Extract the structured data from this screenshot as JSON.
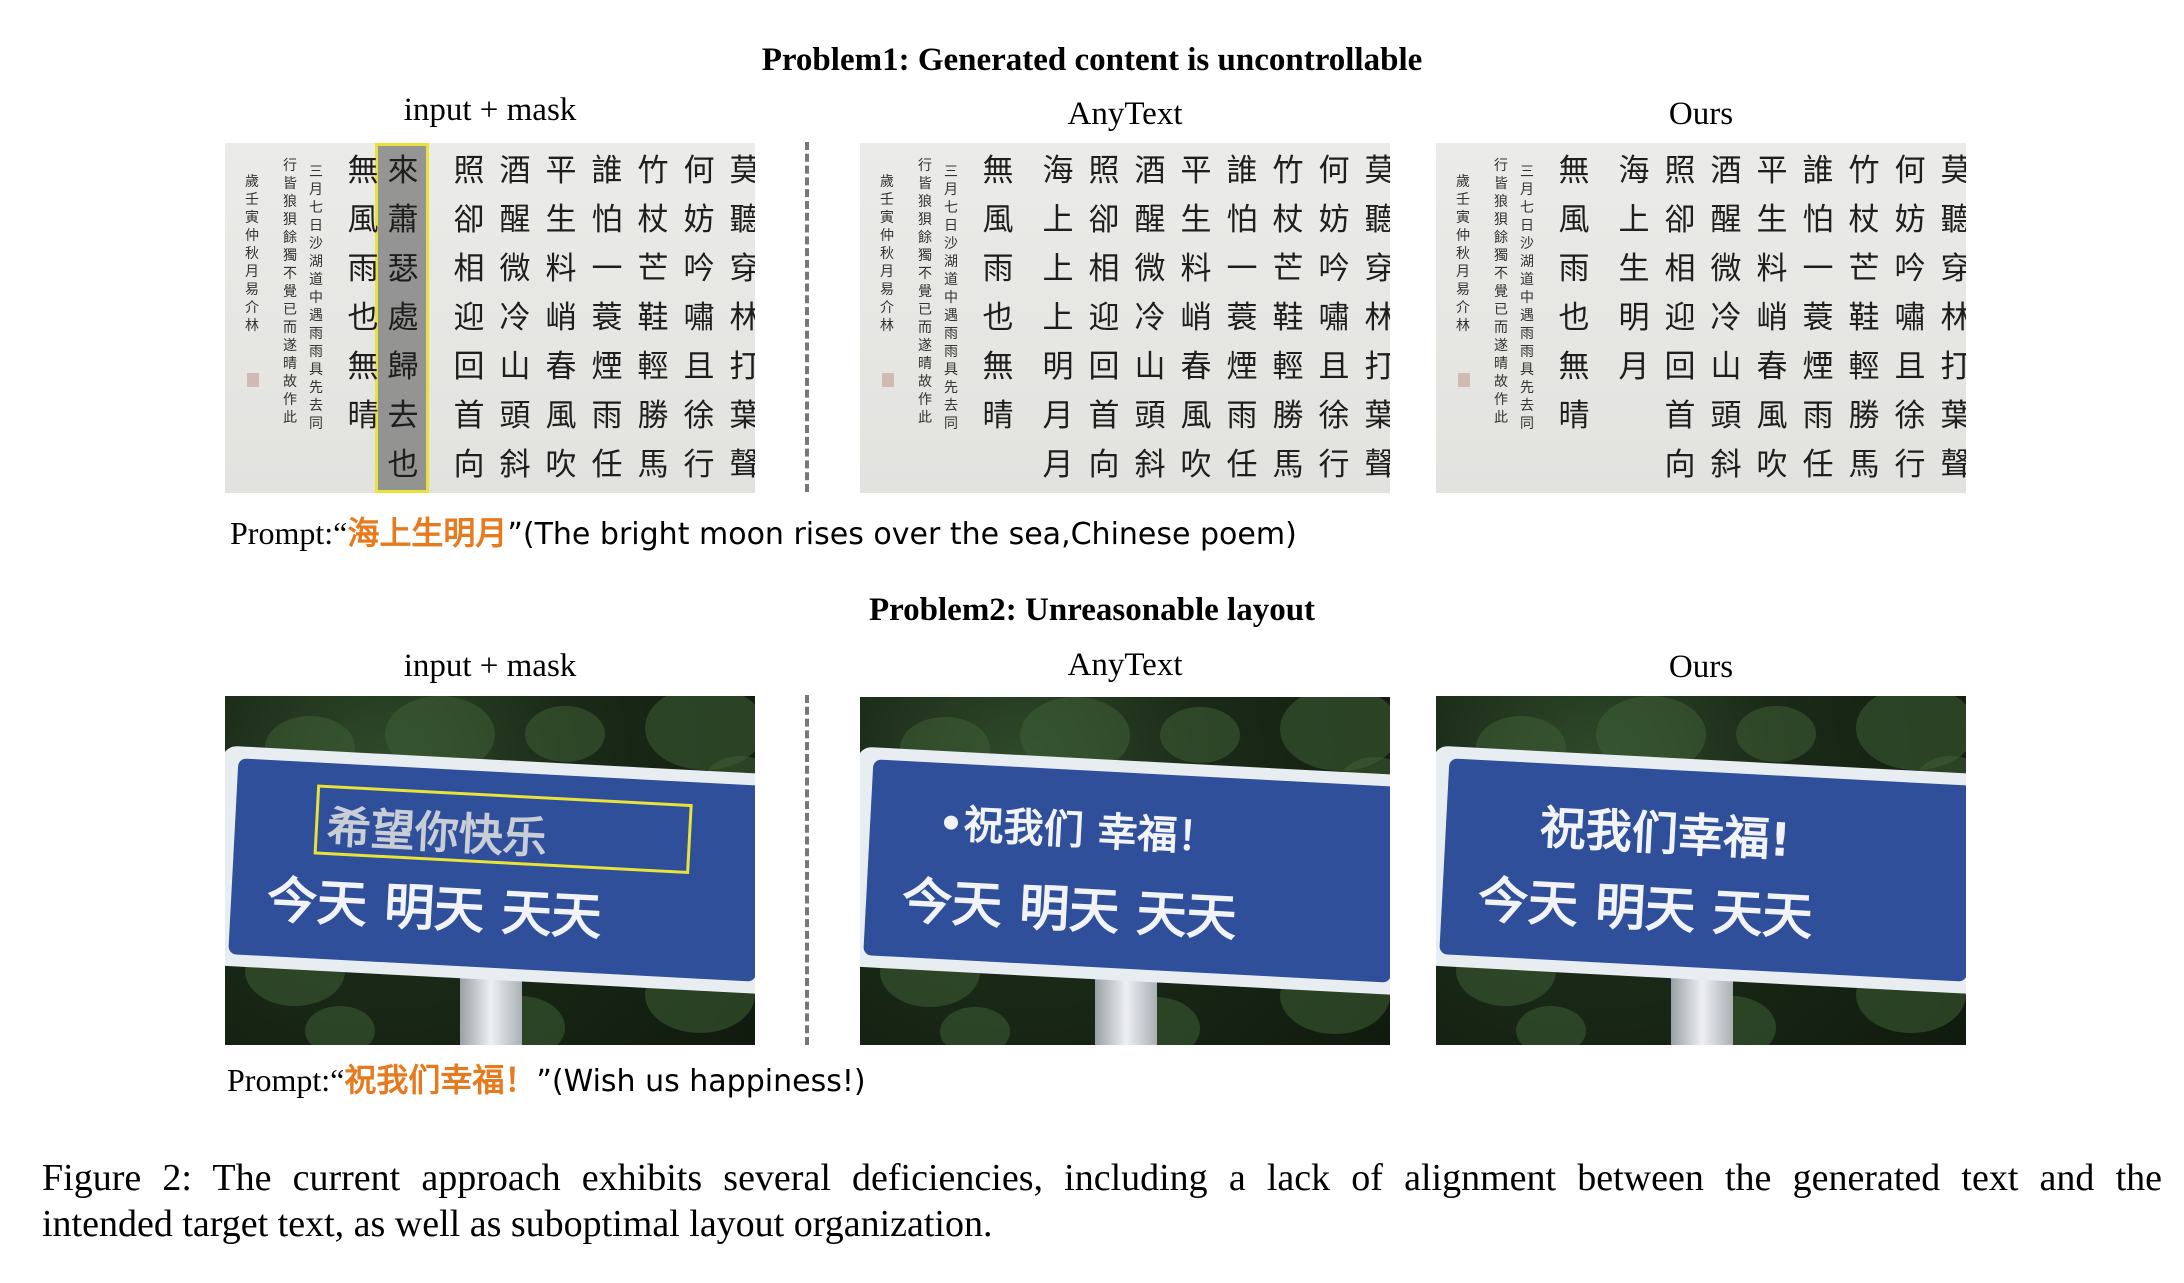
{
  "problem1": {
    "title": "Problem1: Generated content is uncontrollable",
    "labels": [
      "input + mask",
      "AnyText",
      "Ours"
    ],
    "prompt_prefix": "Prompt:“",
    "prompt_text": "海上生明月",
    "prompt_suffix": "”(The bright moon rises over the sea,Chinese poem)",
    "poem_columns": [
      "莫聽穿林打葉聲",
      "何妨吟嘯且徐行",
      "竹杖芒鞋輕勝馬",
      "誰怕一蓑煙雨任",
      "平生料峭春風吹",
      "酒醒微冷山頭斜",
      "照卻相迎回首向"
    ],
    "masked_column": "來蕭瑟處歸去也",
    "anytext_column": "海上上上明月月",
    "ours_column": "海上生明月",
    "last_column": "無風雨也無晴",
    "inscription": [
      "三月七日沙湖道中遇雨雨具先去同",
      "行皆狼狽餘獨不覺已而遂晴故作此",
      "歲壬寅仲秋月 易介林"
    ]
  },
  "problem2": {
    "title": "Problem2: Unreasonable layout",
    "labels": [
      "input + mask",
      "AnyText",
      "Ours"
    ],
    "prompt_prefix": "Prompt:“",
    "prompt_text": "祝我们幸福！",
    "prompt_suffix": "”(Wish us happiness!)",
    "sign_line2": "今天 明天 天天",
    "masked_line1": "希望你快乐",
    "anytext_line1": "•祝我们 幸福！",
    "ours_line1": "祝我们幸福!"
  },
  "caption": {
    "line1": "Figure 2: The current approach exhibits several deficiencies, including a lack of alignment between the generated text and the",
    "line2": "intended target text, as well as suboptimal layout organization."
  },
  "colors": {
    "prompt_highlight": "#e87a1e",
    "mask_border": "#e8e23a",
    "sign_blue": "#2f4f9a"
  }
}
